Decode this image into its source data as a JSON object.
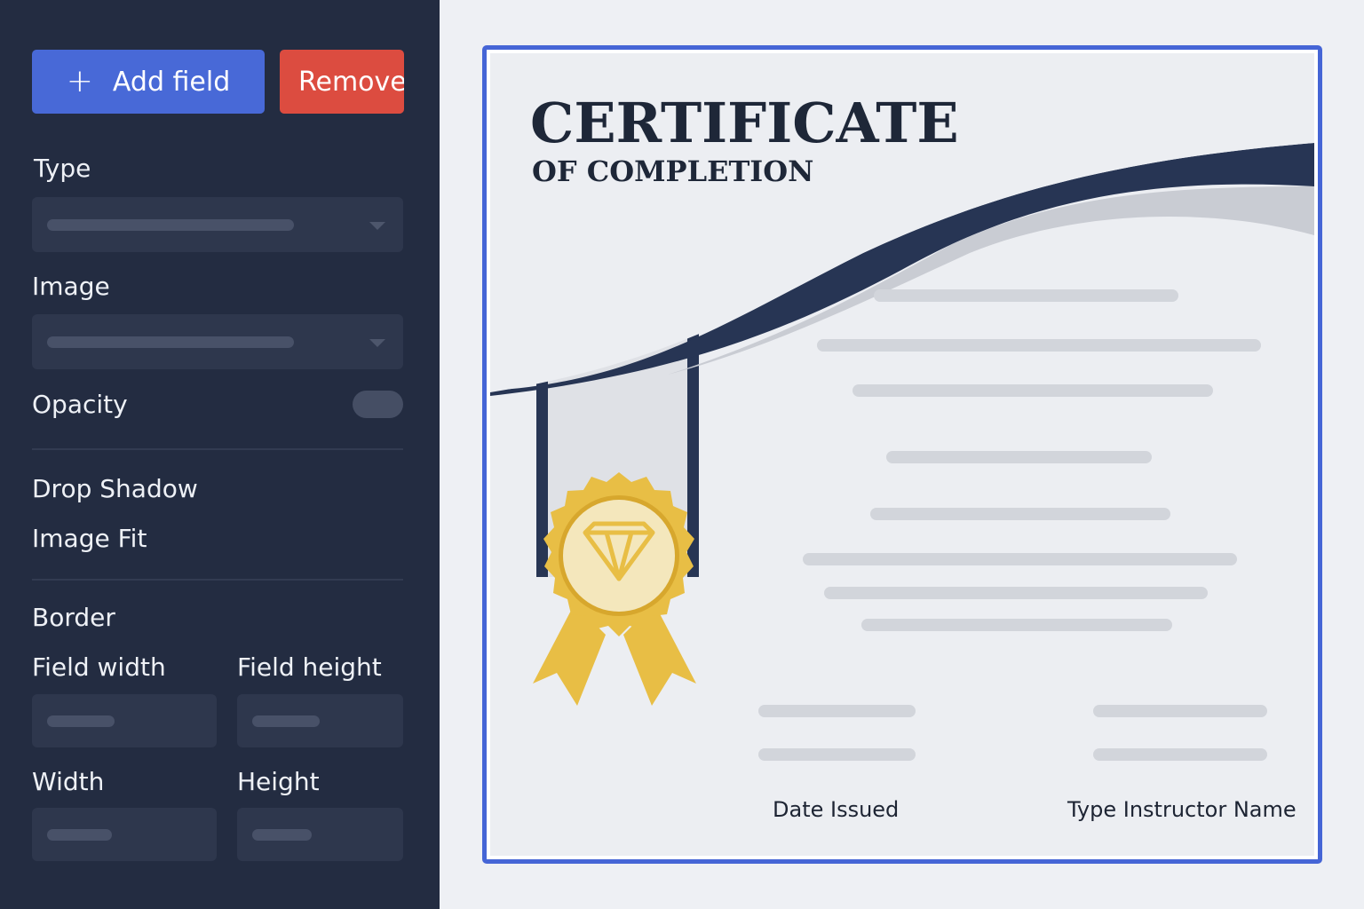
{
  "toolbar": {
    "add_field_label": "Add field",
    "remove_label": "Remove"
  },
  "panel": {
    "type_label": "Type",
    "image_label": "Image",
    "opacity_label": "Opacity",
    "drop_shadow_label": "Drop Shadow",
    "image_fit_label": "Image Fit",
    "border_label": "Border",
    "field_width_label": "Field width",
    "field_height_label": "Field height",
    "width_label": "Width",
    "height_label": "Height"
  },
  "certificate": {
    "title": "CERTIFICATE",
    "subtitle": "OF COMPLETION",
    "date_label": "Date Issued",
    "instructor_label": "Type Instructor Name",
    "badge_icon": "diamond-icon"
  },
  "colors": {
    "sidebar_bg": "#232c41",
    "add_button": "#4869d7",
    "remove_button": "#dc4c40",
    "certificate_border": "#4565d6",
    "navy_accent": "#273554",
    "gold": "#e8be45"
  }
}
